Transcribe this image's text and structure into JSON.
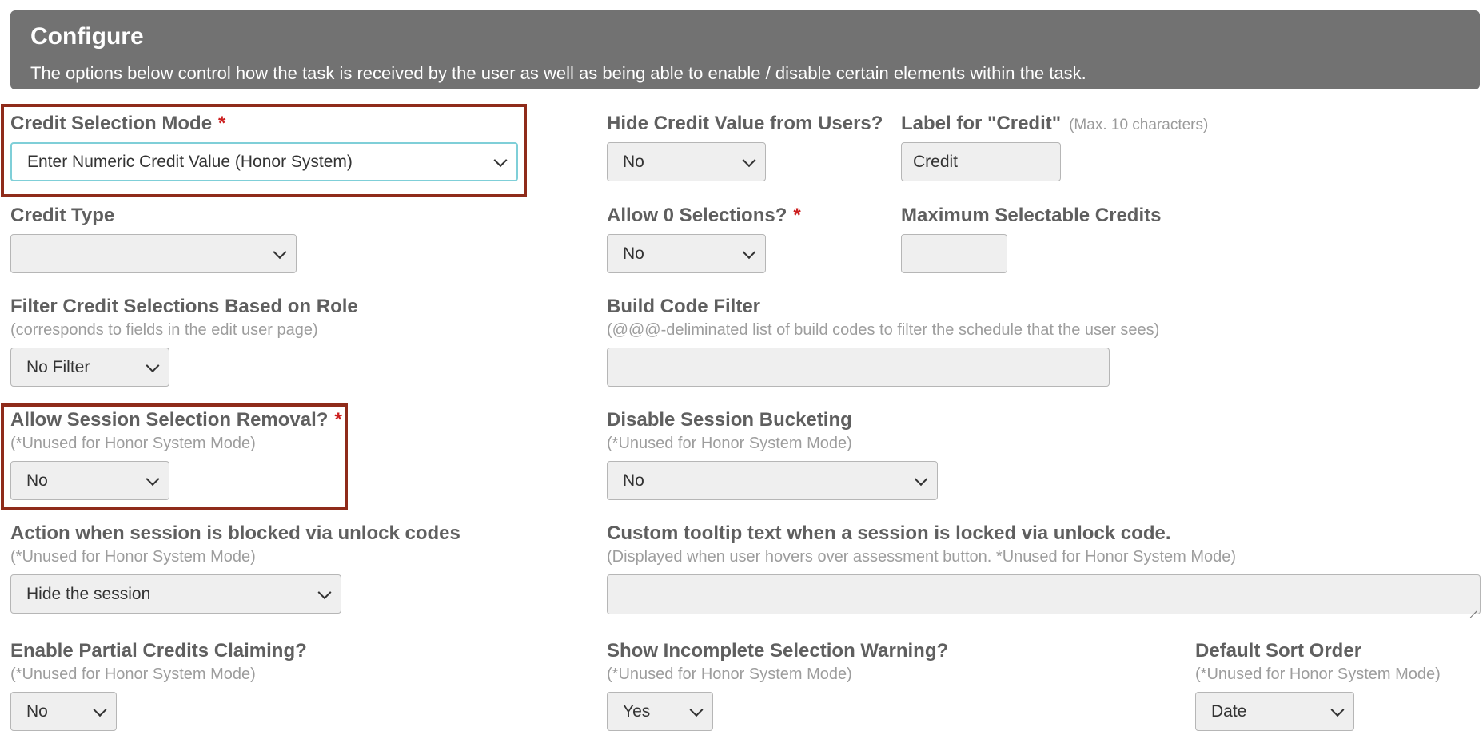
{
  "header": {
    "title": "Configure",
    "description": "The options below control how the task is received by the user as well as being able to enable / disable certain elements within the task."
  },
  "fields": {
    "credit_selection_mode": {
      "label": "Credit Selection Mode",
      "required": "*",
      "value": "Enter Numeric Credit Value (Honor System)"
    },
    "hide_credit_value": {
      "label": "Hide Credit Value from Users?",
      "value": "No"
    },
    "credit_label": {
      "label": "Label for \"Credit\"",
      "note": "(Max. 10 characters)",
      "value": "Credit"
    },
    "credit_type": {
      "label": "Credit Type",
      "value": ""
    },
    "allow_zero": {
      "label": "Allow 0 Selections?",
      "required": "*",
      "value": "No"
    },
    "max_credits": {
      "label": "Maximum Selectable Credits",
      "value": ""
    },
    "filter_by_role": {
      "label": "Filter Credit Selections Based on Role",
      "sub": "(corresponds to fields in the edit user page)",
      "value": "No Filter"
    },
    "build_code_filter": {
      "label": "Build Code Filter",
      "sub": "(@@@-deliminated list of build codes to filter the schedule that the user sees)",
      "value": ""
    },
    "session_removal": {
      "label": "Allow Session Selection Removal?",
      "required": "*",
      "sub": "(*Unused for Honor System Mode)",
      "value": "No"
    },
    "disable_bucketing": {
      "label": "Disable Session Bucketing",
      "sub": "(*Unused for Honor System Mode)",
      "value": "No"
    },
    "blocked_action": {
      "label": "Action when session is blocked via unlock codes",
      "sub": "(*Unused for Honor System Mode)",
      "value": "Hide the session"
    },
    "custom_tooltip": {
      "label": "Custom tooltip text when a session is locked via unlock code.",
      "sub": "(Displayed when user hovers over assessment button. *Unused for Honor System Mode)",
      "value": ""
    },
    "partial_credits": {
      "label": "Enable Partial Credits Claiming?",
      "sub": "(*Unused for Honor System Mode)",
      "value": "No"
    },
    "incomplete_warning": {
      "label": "Show Incomplete Selection Warning?",
      "sub": "(*Unused for Honor System Mode)",
      "value": "Yes"
    },
    "sort_order": {
      "label": "Default Sort Order",
      "sub": "(*Unused for Honor System Mode)",
      "value": "Date"
    }
  },
  "colors": {
    "header_bg": "#727272",
    "highlight_border": "#8f2b1a",
    "required": "#cc1f1f",
    "focus_border": "#7fcfd8"
  },
  "icons": {
    "select": "chevron-down-icon",
    "textarea": "resize-handle-icon"
  }
}
